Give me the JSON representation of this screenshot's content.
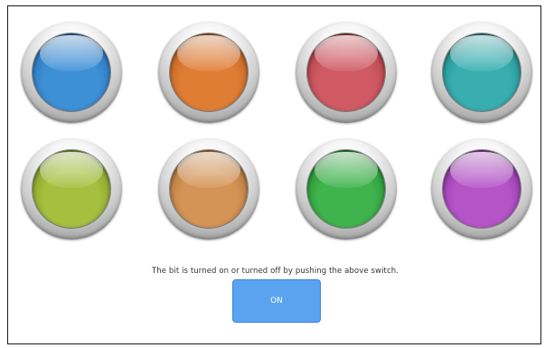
{
  "lamps": [
    {
      "name": "blue",
      "color": "#3d8fd6",
      "dark": "#1c5fa6"
    },
    {
      "name": "orange",
      "color": "#e07d35",
      "dark": "#a44d14"
    },
    {
      "name": "red",
      "color": "#cf5a63",
      "dark": "#972a35"
    },
    {
      "name": "teal",
      "color": "#38aeb0",
      "dark": "#127479"
    },
    {
      "name": "olive",
      "color": "#a6bf3e",
      "dark": "#6b8418"
    },
    {
      "name": "tan",
      "color": "#d49456",
      "dark": "#9a5e25"
    },
    {
      "name": "green",
      "color": "#3fb34c",
      "dark": "#14781f"
    },
    {
      "name": "purple",
      "color": "#b454c7",
      "dark": "#7a1e8e"
    }
  ],
  "caption": "The bit is turned on or turned off by pushing the above switch.",
  "button": {
    "label": "ON",
    "color": "#5aa3f0"
  }
}
